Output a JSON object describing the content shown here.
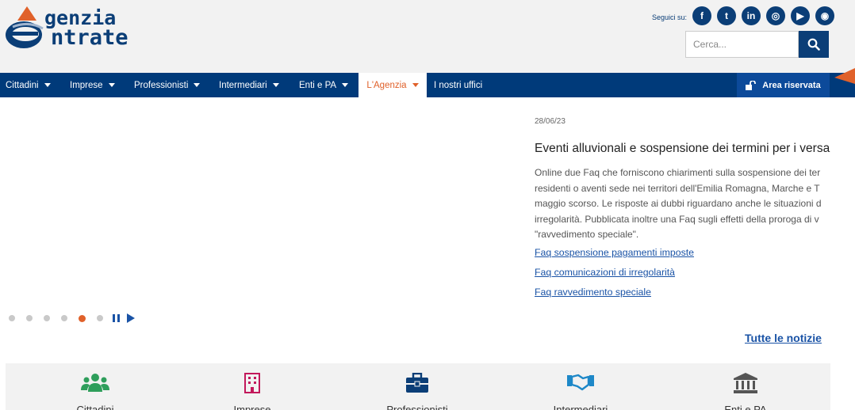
{
  "header": {
    "logo_line1": "genzia",
    "logo_line2": "ntrate",
    "follow_label": "Seguici su:",
    "socials": [
      {
        "icon": "facebook-icon",
        "glyph": "f"
      },
      {
        "icon": "twitter-icon",
        "glyph": "t"
      },
      {
        "icon": "linkedin-icon",
        "glyph": "in"
      },
      {
        "icon": "instagram-icon",
        "glyph": "◎"
      },
      {
        "icon": "youtube-icon",
        "glyph": "▶"
      },
      {
        "icon": "rss-icon",
        "glyph": "◉"
      }
    ],
    "search_placeholder": "Cerca...",
    "brand_color": "#0b3e77",
    "accent_color": "#e0612a"
  },
  "nav": {
    "items": [
      {
        "label": "Cittadini"
      },
      {
        "label": "Imprese"
      },
      {
        "label": "Professionisti"
      },
      {
        "label": "Intermediari"
      },
      {
        "label": "Enti e PA"
      },
      {
        "label": "L'Agenzia"
      },
      {
        "label": "I nostri uffici"
      }
    ],
    "active": "L'Agenzia",
    "area_riservata": "Area riservata"
  },
  "news": {
    "date": "28/06/23",
    "title": "Eventi alluvionali e sospensione dei termini per i versa",
    "body_lines": [
      "Online due Faq che forniscono chiarimenti sulla sospensione dei ter",
      "residenti o aventi sede nei territori dell'Emilia Romagna, Marche e T",
      "maggio scorso. Le risposte ai dubbi riguardano anche le situazioni d",
      "irregolarità. Pubblicata inoltre una Faq sugli effetti della proroga di v",
      "\"ravvedimento speciale\"."
    ],
    "links": [
      "Faq sospensione pagamenti imposte",
      "Faq comunicazioni di irregolarità",
      "Faq ravvedimento speciale"
    ],
    "all_news": "Tutte le notizie"
  },
  "carousel": {
    "slide_count": 6,
    "active_slide": 5
  },
  "categories": [
    {
      "label": "Cittadini",
      "icon": "people-icon",
      "color": "#2e9e5b"
    },
    {
      "label": "Imprese",
      "icon": "building-icon",
      "color": "#c2185b"
    },
    {
      "label": "Professionisti",
      "icon": "briefcase-icon",
      "color": "#0b3e77"
    },
    {
      "label": "Intermediari",
      "icon": "handshake-icon",
      "color": "#1e88c8"
    },
    {
      "label": "Enti e PA",
      "icon": "institution-icon",
      "color": "#555555"
    }
  ]
}
